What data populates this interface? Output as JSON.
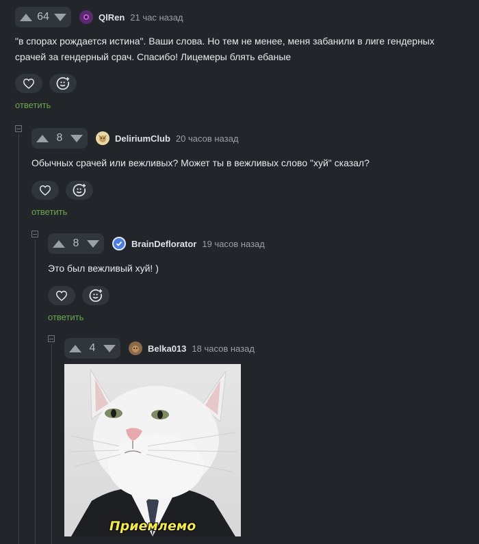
{
  "comments": [
    {
      "score": "64",
      "author": "QlRen",
      "time": "21 час назад",
      "text_lines": [
        "\"в спорах рождается истина\". Ваши слова. Но тем не менее, меня забанили в лиге гендерных",
        "срачей за гендерный срач. Спасибо! Лицемеры блять ебаные"
      ],
      "reply_label": "ответить",
      "avatar_color": "#5a2a6e"
    },
    {
      "score": "8",
      "author": "DeliriumClub",
      "time": "20 часов назад",
      "text": "Обычных срачей или вежливых? Может ты в вежливых слово \"хуй\" сказал?",
      "reply_label": "ответить",
      "avatar_color": "#e8d8a8"
    },
    {
      "score": "8",
      "author": "BrainDeflorator",
      "time": "19 часов назад",
      "text": "Это был вежливый хуй! )",
      "reply_label": "ответить",
      "avatar_color": "#4a7fe0"
    },
    {
      "score": "4",
      "author": "Belka013",
      "time": "18 часов назад",
      "image_caption": "Приемлемо",
      "avatar_color": "#8a6a4a"
    }
  ],
  "icons": {
    "upvote": "triangle-up-icon",
    "downvote": "triangle-down-icon",
    "like": "heart-icon",
    "react": "emoji-plus-icon",
    "collapse": "minus-square-icon",
    "verified": "checkmark-badge-icon"
  },
  "colors": {
    "background": "#22262a",
    "reply_link": "#6aa84f"
  }
}
